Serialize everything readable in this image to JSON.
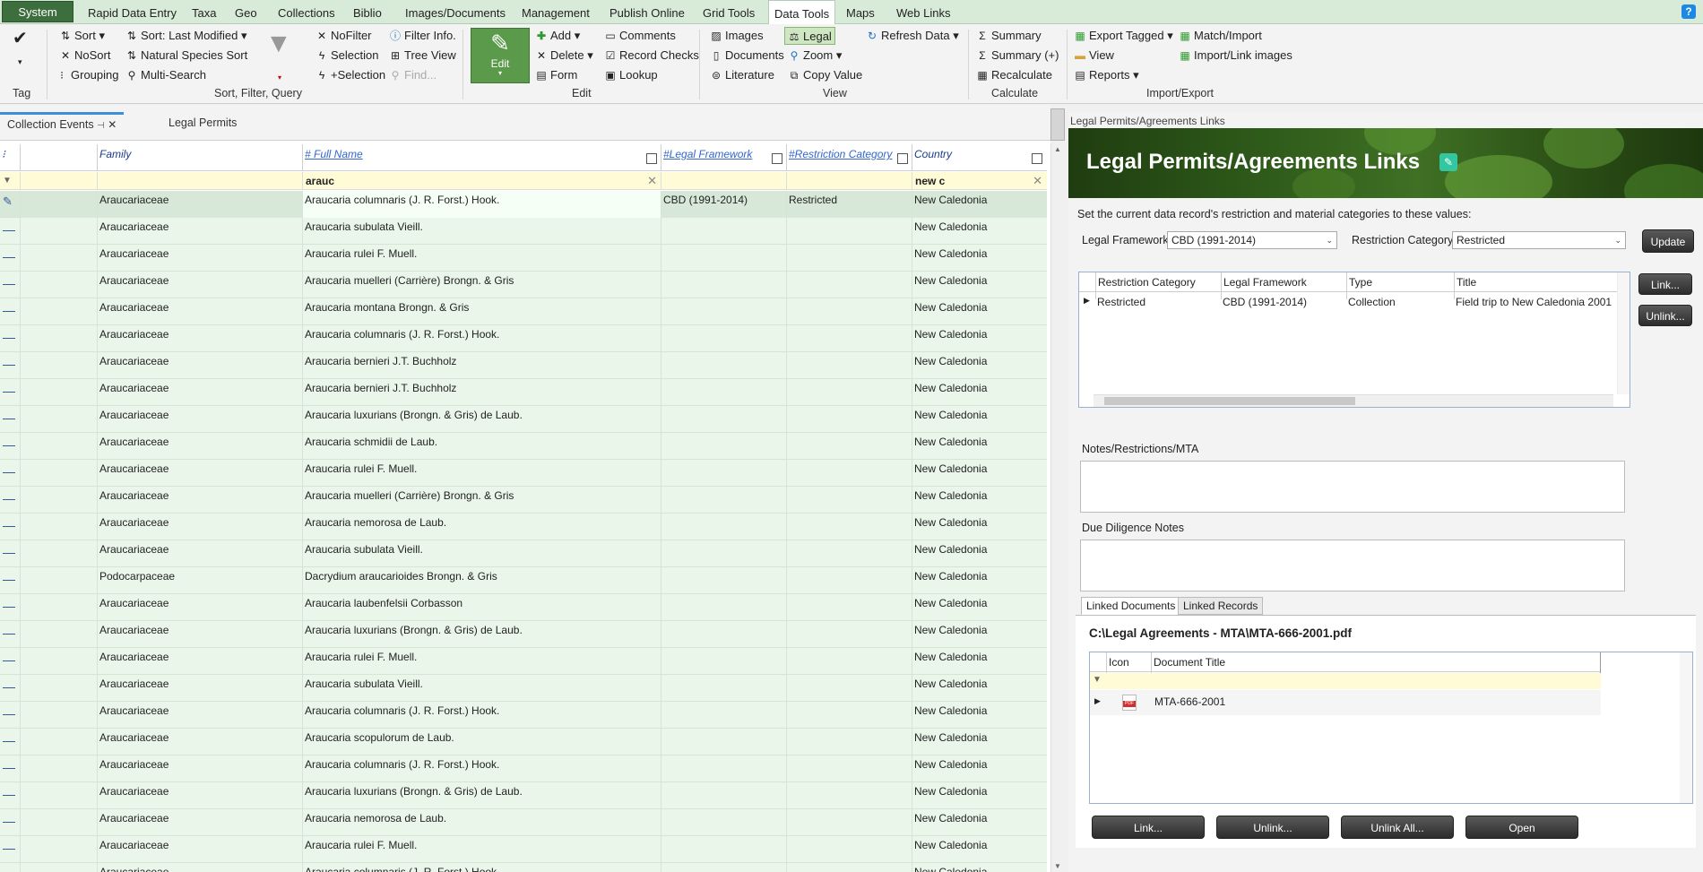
{
  "menu": {
    "tabs": [
      "System",
      "Rapid Data Entry",
      "Taxa",
      "Geo",
      "Collections",
      "Biblio",
      "Images/Documents",
      "Management",
      "Publish Online",
      "Grid Tools",
      "Data Tools",
      "Maps",
      "Web Links"
    ],
    "help": "?"
  },
  "ribbon": {
    "tag_group": "Tag",
    "sort": "Sort",
    "sort_last": "Sort: Last Modified",
    "nosort": "NoSort",
    "natural_sort": "Natural Species Sort",
    "grouping": "Grouping",
    "multi_search": "Multi-Search",
    "nofilter": "NoFilter",
    "filter_info": "Filter Info.",
    "selection": "Selection",
    "tree_view": "Tree View",
    "plus_selection": "+Selection",
    "find": "Find...",
    "sfq_group": "Sort, Filter, Query",
    "edit": "Edit",
    "add": "Add",
    "delete": "Delete",
    "form": "Form",
    "comments": "Comments",
    "record_checks": "Record Checks",
    "lookup": "Lookup",
    "edit_group": "Edit",
    "images": "Images",
    "legal": "Legal",
    "documents": "Documents",
    "zoom": "Zoom",
    "literature": "Literature",
    "copy_value": "Copy Value",
    "view_group": "View",
    "refresh_data": "Refresh Data",
    "summary": "Summary",
    "summary_plus": "Summary (+)",
    "recalculate": "Recalculate",
    "calculate_group": "Calculate",
    "export_tagged": "Export Tagged",
    "view": "View",
    "reports": "Reports",
    "match_import": "Match/Import",
    "import_link_images": "Import/Link images",
    "import_export_group": "Import/Export"
  },
  "doc_tabs": [
    "Collection Events",
    "Legal Permits"
  ],
  "grid": {
    "columns": [
      "Family",
      "# Full Name",
      "#Legal Framework",
      "#Restriction Category",
      "Country"
    ],
    "filters": {
      "full_name": "arauc",
      "country": "new c"
    },
    "rows": [
      [
        "Araucariaceae",
        "Araucaria columnaris (J. R. Forst.) Hook.",
        "CBD (1991-2014)",
        "Restricted",
        "New Caledonia"
      ],
      [
        "Araucariaceae",
        "Araucaria subulata Vieill.",
        "",
        "",
        "New Caledonia"
      ],
      [
        "Araucariaceae",
        "Araucaria rulei F. Muell.",
        "",
        "",
        "New Caledonia"
      ],
      [
        "Araucariaceae",
        "Araucaria muelleri (Carrière) Brongn. & Gris",
        "",
        "",
        "New Caledonia"
      ],
      [
        "Araucariaceae",
        "Araucaria montana Brongn. & Gris",
        "",
        "",
        "New Caledonia"
      ],
      [
        "Araucariaceae",
        "Araucaria columnaris (J. R. Forst.) Hook.",
        "",
        "",
        "New Caledonia"
      ],
      [
        "Araucariaceae",
        "Araucaria bernieri J.T. Buchholz",
        "",
        "",
        "New Caledonia"
      ],
      [
        "Araucariaceae",
        "Araucaria bernieri J.T. Buchholz",
        "",
        "",
        "New Caledonia"
      ],
      [
        "Araucariaceae",
        "Araucaria luxurians (Brongn. & Gris) de Laub.",
        "",
        "",
        "New Caledonia"
      ],
      [
        "Araucariaceae",
        "Araucaria schmidii de Laub.",
        "",
        "",
        "New Caledonia"
      ],
      [
        "Araucariaceae",
        "Araucaria rulei F. Muell.",
        "",
        "",
        "New Caledonia"
      ],
      [
        "Araucariaceae",
        "Araucaria muelleri (Carrière) Brongn. & Gris",
        "",
        "",
        "New Caledonia"
      ],
      [
        "Araucariaceae",
        "Araucaria nemorosa de Laub.",
        "",
        "",
        "New Caledonia"
      ],
      [
        "Araucariaceae",
        "Araucaria subulata Vieill.",
        "",
        "",
        "New Caledonia"
      ],
      [
        "Podocarpaceae",
        "Dacrydium araucarioides Brongn. & Gris",
        "",
        "",
        "New Caledonia"
      ],
      [
        "Araucariaceae",
        "Araucaria laubenfelsii Corbasson",
        "",
        "",
        "New Caledonia"
      ],
      [
        "Araucariaceae",
        "Araucaria luxurians (Brongn. & Gris) de Laub.",
        "",
        "",
        "New Caledonia"
      ],
      [
        "Araucariaceae",
        "Araucaria rulei F. Muell.",
        "",
        "",
        "New Caledonia"
      ],
      [
        "Araucariaceae",
        "Araucaria subulata Vieill.",
        "",
        "",
        "New Caledonia"
      ],
      [
        "Araucariaceae",
        "Araucaria columnaris (J. R. Forst.) Hook.",
        "",
        "",
        "New Caledonia"
      ],
      [
        "Araucariaceae",
        "Araucaria scopulorum de Laub.",
        "",
        "",
        "New Caledonia"
      ],
      [
        "Araucariaceae",
        "Araucaria columnaris (J. R. Forst.) Hook.",
        "",
        "",
        "New Caledonia"
      ],
      [
        "Araucariaceae",
        "Araucaria luxurians (Brongn. & Gris) de Laub.",
        "",
        "",
        "New Caledonia"
      ],
      [
        "Araucariaceae",
        "Araucaria nemorosa de Laub.",
        "",
        "",
        "New Caledonia"
      ],
      [
        "Araucariaceae",
        "Araucaria rulei F. Muell.",
        "",
        "",
        "New Caledonia"
      ],
      [
        "Araucariaceae",
        "Araucaria columnaris (J. R. Forst.) Hook.",
        "",
        "",
        "New Caledonia"
      ]
    ]
  },
  "right": {
    "pane_title": "Legal Permits/Agreements Links",
    "banner_title": "Legal Permits/Agreements Links",
    "instruction": "Set the current data record's restriction and material categories to these values:",
    "legal_framework_label": "Legal Framework",
    "legal_framework_value": "CBD (1991-2014)",
    "restriction_label": "Restriction Category",
    "restriction_value": "Restricted",
    "update": "Update",
    "link": "Link...",
    "unlink": "Unlink...",
    "links_columns": [
      "Restriction Category",
      "Legal Framework",
      "Type",
      "Title"
    ],
    "links_rows": [
      [
        "Restricted",
        "CBD (1991-2014)",
        "Collection",
        "Field trip to New Caledonia 2001"
      ]
    ],
    "notes_label": "Notes/Restrictions/MTA",
    "due_label": "Due Diligence Notes",
    "subtabs": [
      "Linked Documents",
      "Linked Records"
    ],
    "doc_path": "C:\\Legal Agreements - MTA\\MTA-666-2001.pdf",
    "doc_columns": [
      "Icon",
      "Document Title"
    ],
    "doc_rows": [
      {
        "icon": "pdf-icon",
        "title": "MTA-666-2001"
      }
    ],
    "pdf_badge": "PDF",
    "buttons": [
      "Link...",
      "Unlink...",
      "Unlink All...",
      "Open"
    ]
  }
}
